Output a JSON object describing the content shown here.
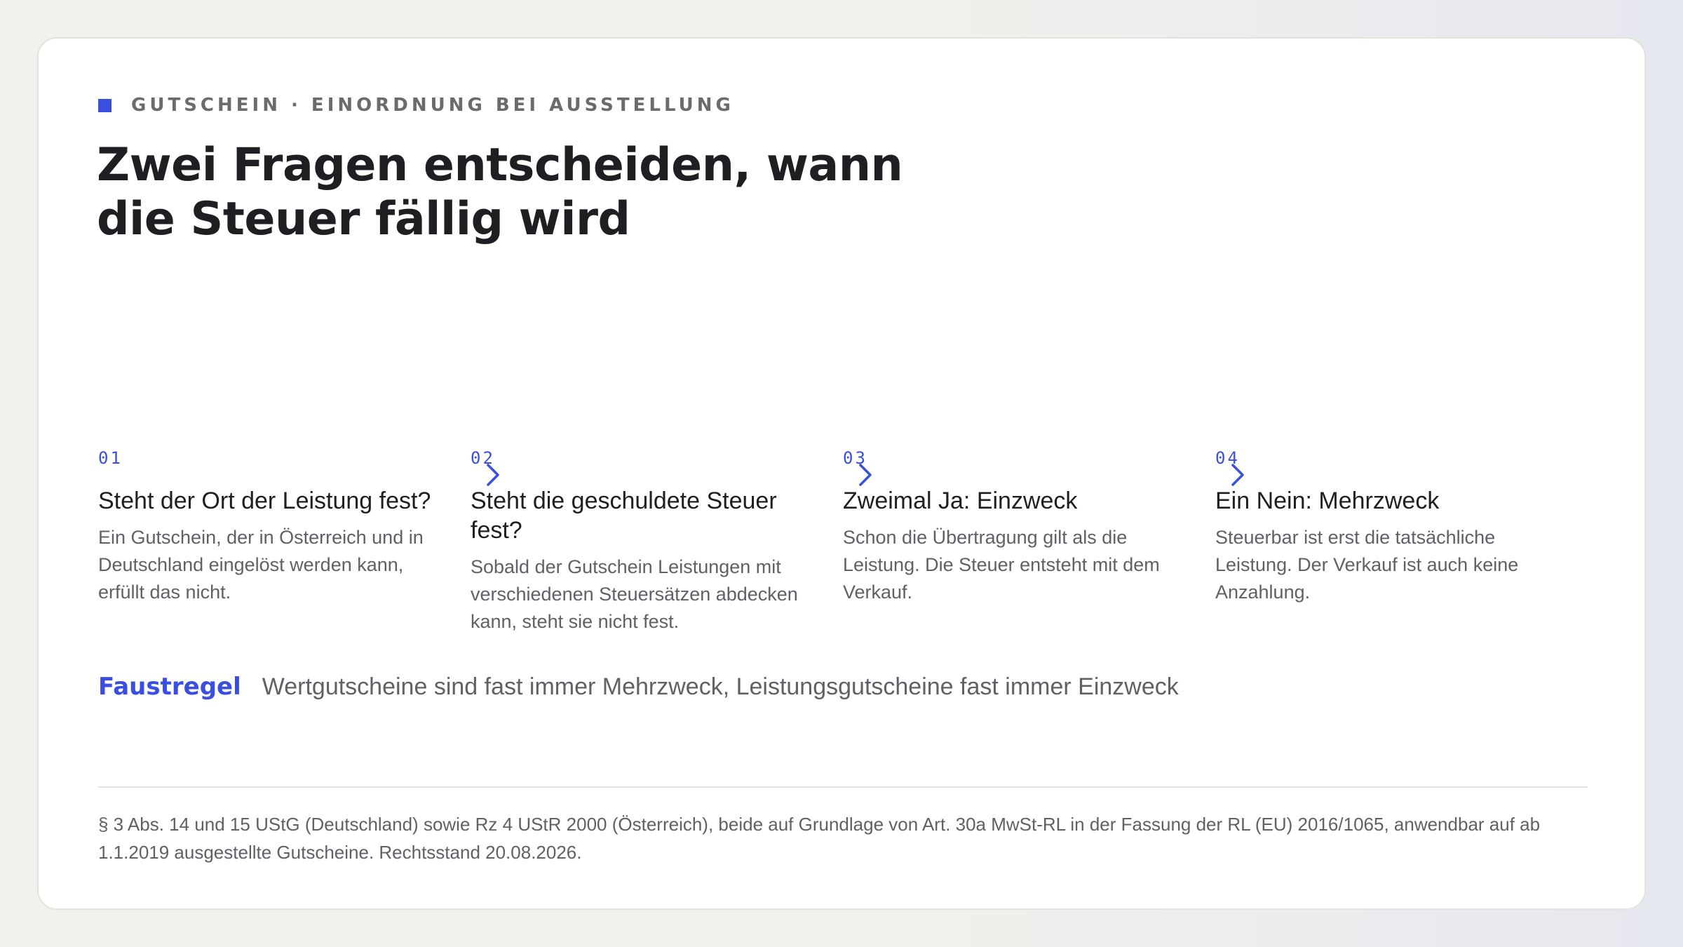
{
  "eyebrow": "GUTSCHEIN · EINORDNUNG BEI AUSSTELLUNG",
  "headline": "Zwei Fragen entscheiden, wann die Steuer fällig wird",
  "steps": [
    {
      "num": "01",
      "title": "Steht der Ort der Leistung fest?",
      "desc": "Ein Gutschein, der in Österreich und in Deutschland eingelöst werden kann, erfüllt das nicht."
    },
    {
      "num": "02",
      "title": "Steht die geschuldete Steuer fest?",
      "desc": "Sobald der Gutschein Leistungen mit verschiedenen Steuersätzen abdecken kann, steht sie nicht fest."
    },
    {
      "num": "03",
      "title": "Zweimal Ja: Einzweck",
      "desc": "Schon die Übertragung gilt als die Leistung. Die Steuer entsteht mit dem Verkauf."
    },
    {
      "num": "04",
      "title": "Ein Nein: Mehrzweck",
      "desc": "Steuerbar ist erst die tatsächliche Leistung. Der Verkauf ist auch keine Anzahlung."
    }
  ],
  "rule": {
    "label": "Faustregel",
    "text": "Wertgutscheine sind fast immer Mehrzweck, Leistungsgutscheine fast immer Einzweck"
  },
  "footnote": "§ 3 Abs. 14 und 15 UStG (Deutschland) sowie Rz 4 UStR 2000 (Österreich), beide auf Grundlage von Art. 30a MwSt-RL in der Fassung der RL (EU) 2016/1065, anwendbar auf ab 1.1.2019 ausgestellte Gutscheine. Rechtsstand 20.08.2026.",
  "colors": {
    "accent": "#3a4fe0",
    "heading": "#1e1f22",
    "body": "#5f6166"
  },
  "icons": {
    "eyebrow_marker": "square-marker-icon",
    "step_separator": "chevron-right-icon"
  }
}
